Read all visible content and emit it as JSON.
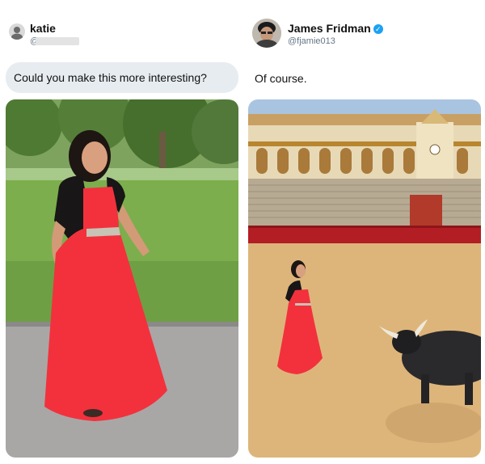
{
  "left_post": {
    "user_name": "katie",
    "handle_prefix": "@",
    "handle_hidden": true,
    "message": "Could you make this more interesting?",
    "avatar_icon": "user-avatar-icon",
    "photo_subject": "woman-in-red-dress-photo"
  },
  "right_post": {
    "user_name": "James Fridman",
    "verified_icon": "verified-badge-icon",
    "verified_glyph": "✓",
    "handle": "@fjamie013",
    "message": "Of course.",
    "avatar_icon": "user-avatar-icon",
    "photo_subject": "bullfight-arena-photo"
  },
  "colors": {
    "dress": "#f2313d",
    "bubble": "#e6ecf0",
    "handle": "#657786",
    "verified": "#1da1f2",
    "arena_sand": "#ddb57a",
    "stands_red": "#b21e24"
  }
}
